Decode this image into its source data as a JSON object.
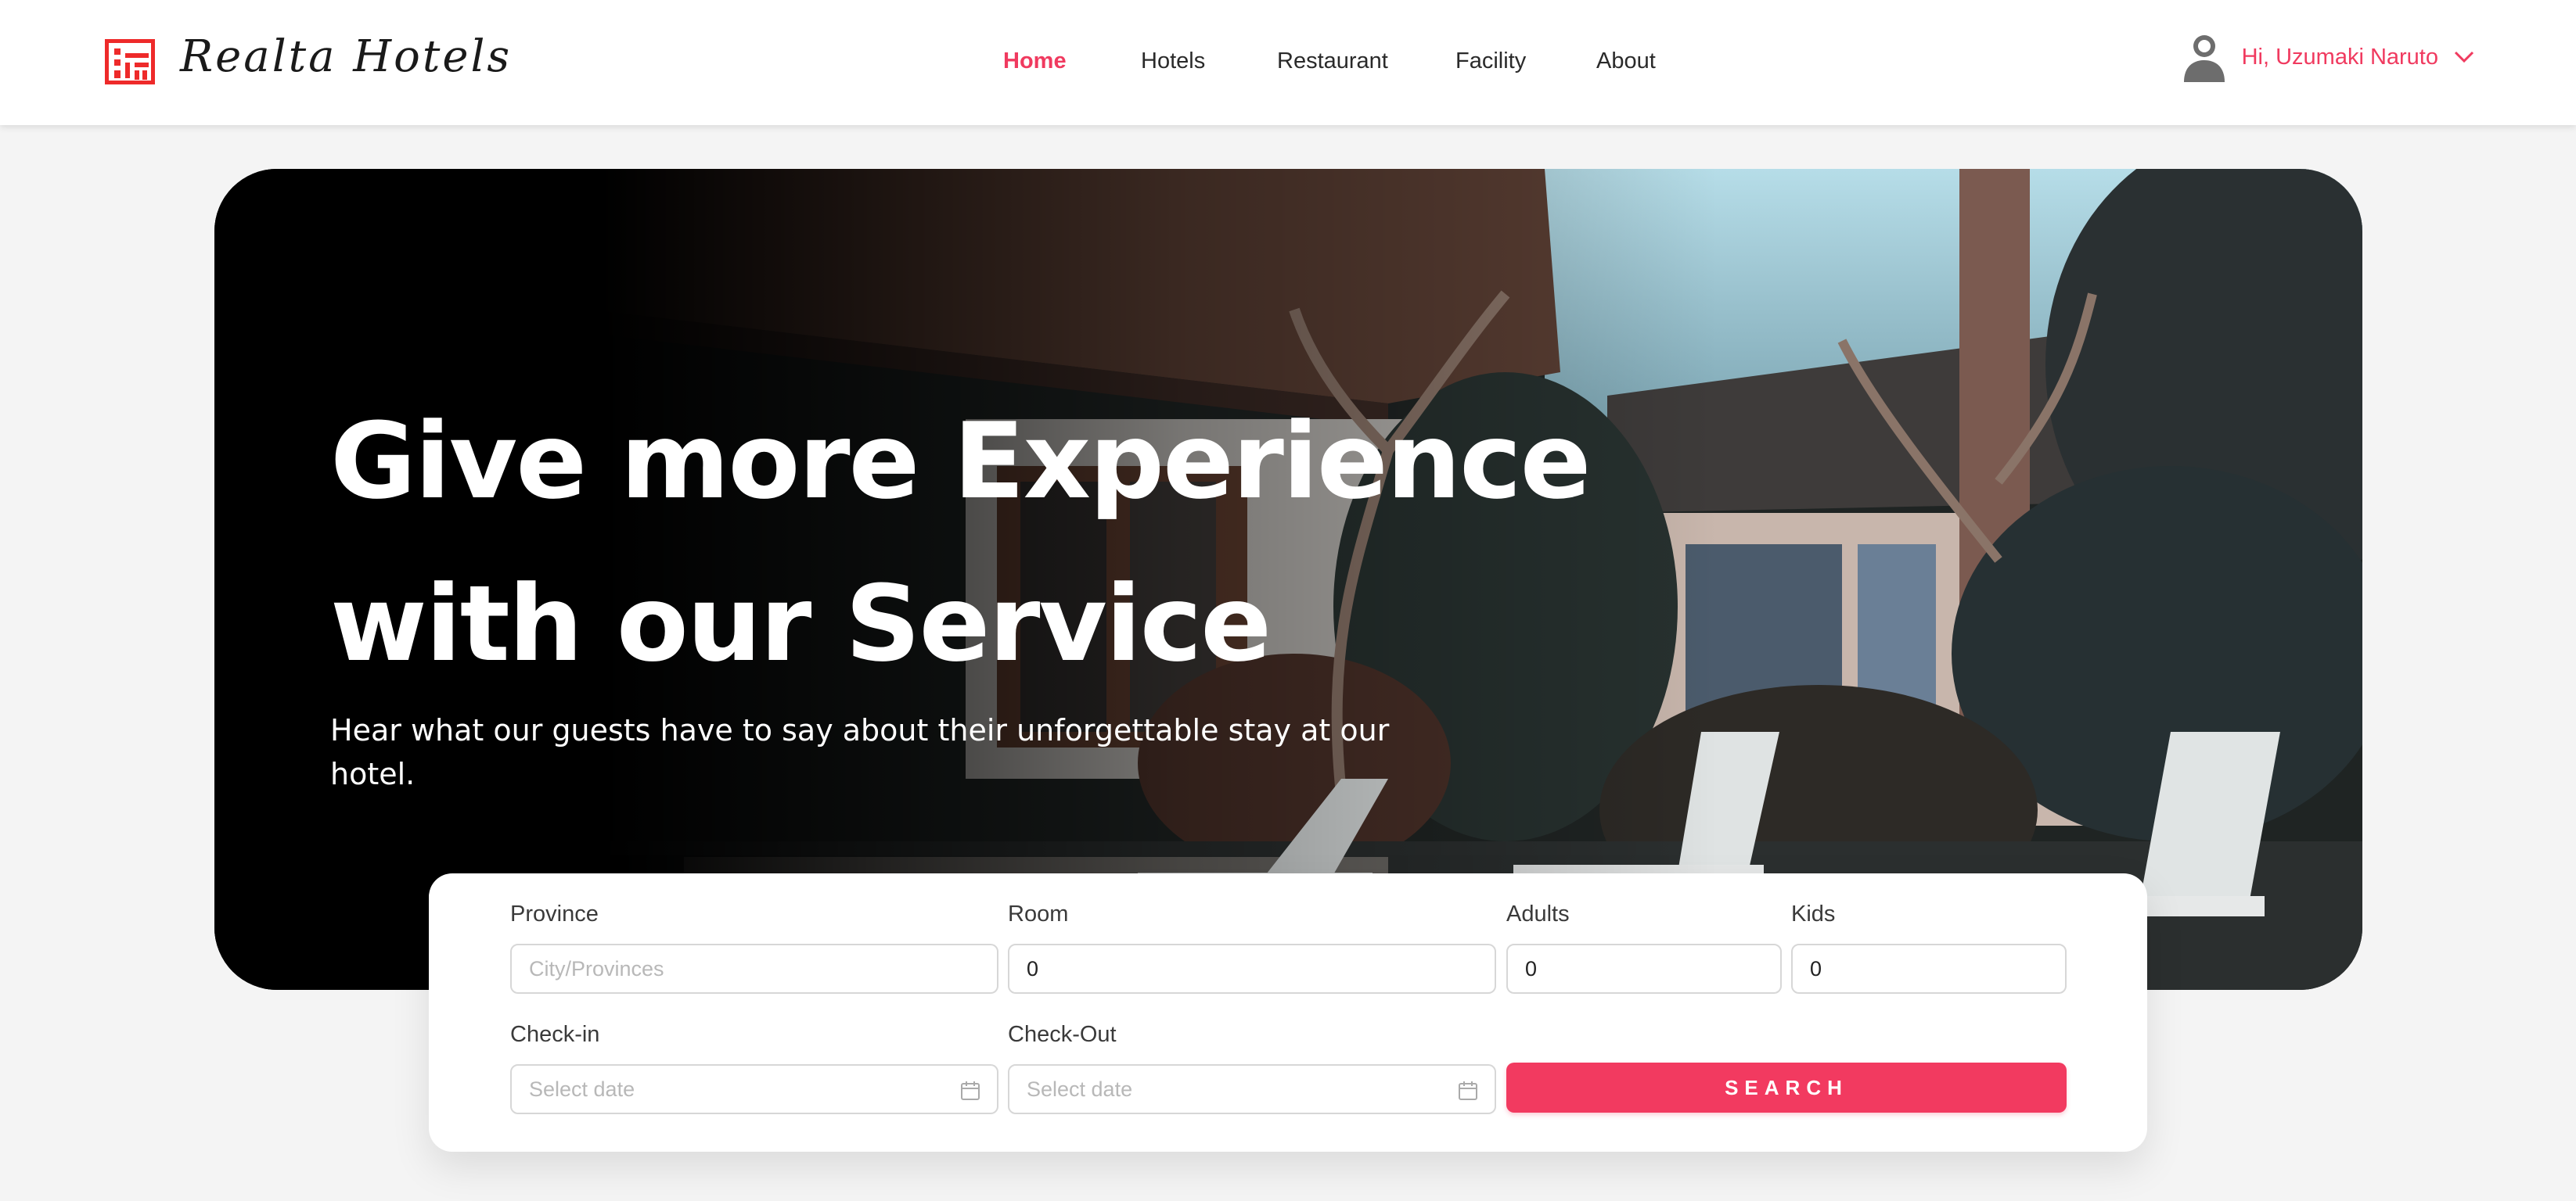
{
  "brand": {
    "name": "Realta Hotels",
    "icon": "building-icon",
    "color": "#f03a5f"
  },
  "nav": {
    "items": [
      {
        "label": "Home",
        "active": true
      },
      {
        "label": "Hotels",
        "active": false
      },
      {
        "label": "Restaurant",
        "active": false
      },
      {
        "label": "Facility",
        "active": false
      },
      {
        "label": "About",
        "active": false
      }
    ]
  },
  "user": {
    "greeting": "Hi, Uzumaki Naruto",
    "icon": "user-avatar-icon",
    "dropdown_icon": "chevron-down-icon"
  },
  "hero": {
    "title_line1": "Give more Experience",
    "title_line2": "with our Service",
    "subtitle": "Hear what our guests have to say about their unforgettable stay at our hotel."
  },
  "search": {
    "province": {
      "label": "Province",
      "placeholder": "City/Provinces",
      "value": ""
    },
    "room": {
      "label": "Room",
      "value": "0"
    },
    "adults": {
      "label": "Adults",
      "value": "0"
    },
    "kids": {
      "label": "Kids",
      "value": "0"
    },
    "checkin": {
      "label": "Check-in",
      "placeholder": "Select date",
      "icon": "calendar-icon"
    },
    "checkout": {
      "label": "Check-Out",
      "placeholder": "Select date",
      "icon": "calendar-icon"
    },
    "button_label": "SEARCH"
  },
  "colors": {
    "accent": "#f03a5f",
    "button": "#f23a60",
    "background": "#f4f4f4"
  }
}
